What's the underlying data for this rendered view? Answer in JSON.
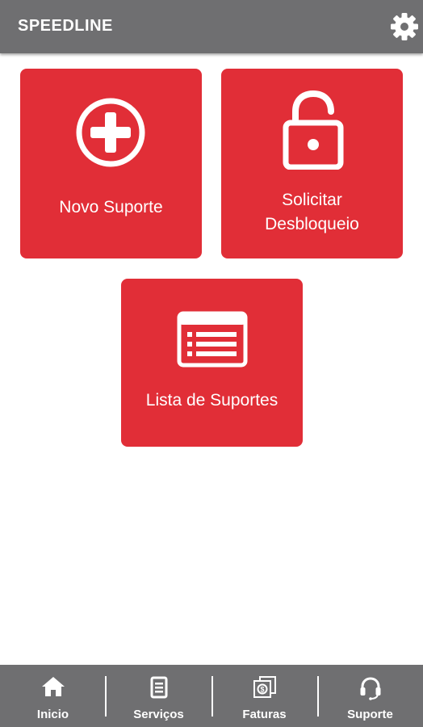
{
  "header": {
    "title": "SPEEDLINE",
    "settings_icon": "gear-icon"
  },
  "tiles": [
    {
      "label": "Novo Suporte",
      "icon": "plus-circle-icon"
    },
    {
      "label": "Solicitar\nDesbloqueio",
      "icon": "unlocked-padlock-icon"
    },
    {
      "label": "Lista de Suportes",
      "icon": "list-icon"
    }
  ],
  "bottom_nav": [
    {
      "label": "Inicio",
      "icon": "home-icon"
    },
    {
      "label": "Serviços",
      "icon": "document-icon"
    },
    {
      "label": "Faturas",
      "icon": "money-icon"
    },
    {
      "label": "Suporte",
      "icon": "headset-icon"
    }
  ],
  "colors": {
    "bar": "#6f6f71",
    "accent": "#e12e37",
    "text_on_dark": "#ffffff"
  }
}
